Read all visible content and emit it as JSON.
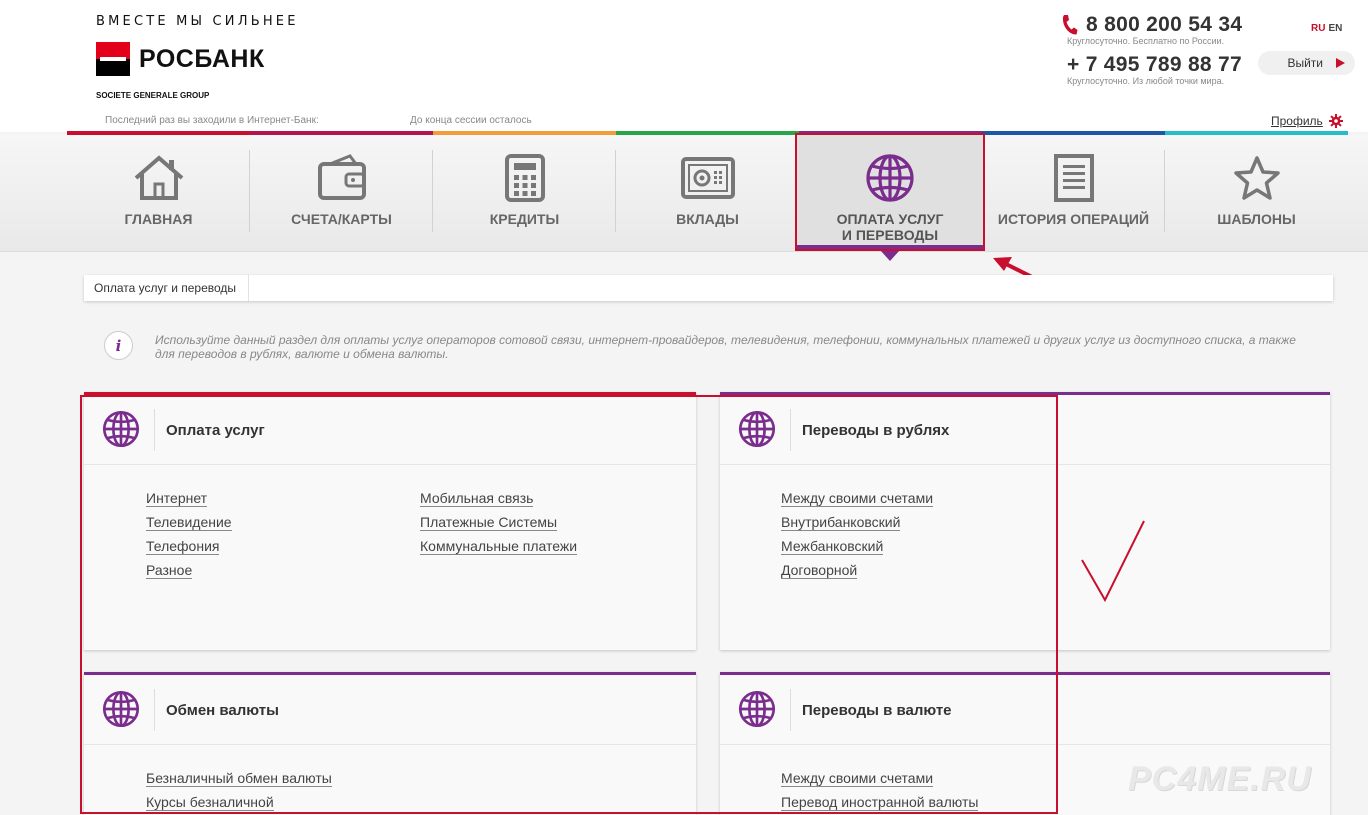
{
  "header": {
    "slogan": "ВМЕСТЕ МЫ СИЛЬНЕЕ",
    "logo_text": "РОСБАНК",
    "group": "SOCIETE GENERALE GROUP",
    "last_visit": "Последний раз вы заходили в Интернет-Банк:",
    "session": "До конца сессии осталось",
    "phone1": "8 800 200 54 34",
    "phone1_note": "Круглосуточно. Бесплатно по России.",
    "phone2": "+ 7 495 789 88 77",
    "phone2_note": "Круглосуточно. Из любой точки мира.",
    "lang_ru": "RU",
    "lang_en": "EN",
    "logout": "Выйти",
    "profile": "Профиль",
    "colors": {
      "accent": "#c8102e",
      "brand_purple": "#7b2d8e"
    }
  },
  "nav": {
    "items": [
      {
        "label": "ГЛАВНАЯ",
        "icon": "home-icon"
      },
      {
        "label": "СЧЕТА/КАРТЫ",
        "icon": "wallet-icon"
      },
      {
        "label": "КРЕДИТЫ",
        "icon": "calculator-icon"
      },
      {
        "label": "ВКЛАДЫ",
        "icon": "safe-icon"
      },
      {
        "label_line1": "ОПЛАТА УСЛУГ",
        "label_line2": "И ПЕРЕВОДЫ",
        "icon": "globe-icon",
        "active": true
      },
      {
        "label": "ИСТОРИЯ ОПЕРАЦИЙ",
        "icon": "document-icon"
      },
      {
        "label": "ШАБЛОНЫ",
        "icon": "star-icon"
      }
    ]
  },
  "breadcrumb": {
    "current": "Оплата услуг и переводы"
  },
  "info": {
    "text": "Используйте данный раздел для оплаты услуг операторов сотовой связи, интернет-провайдеров, телевидения, телефонии, коммунальных платежей и других услуг из доступного списка, а также для переводов в рублях, валюте и обмена валюты."
  },
  "cards": {
    "payments": {
      "title": "Оплата услуг",
      "col1": [
        "Интернет",
        "Телевидение",
        "Телефония",
        "Разное"
      ],
      "col2": [
        "Мобильная связь",
        "Платежные Системы",
        "Коммунальные платежи"
      ]
    },
    "rub_transfers": {
      "title": "Переводы в рублях",
      "links": [
        "Между своими счетами",
        "Внутрибанковский",
        "Межбанковский",
        "Договорной"
      ]
    },
    "exchange": {
      "title": "Обмен валюты",
      "links": [
        "Безналичный обмен валюты",
        "Курсы безналичной"
      ]
    },
    "fx_transfers": {
      "title": "Переводы в валюте",
      "links": [
        "Между своими счетами",
        "Перевод иностранной валюты"
      ]
    }
  },
  "watermark": "PC4ME.RU"
}
